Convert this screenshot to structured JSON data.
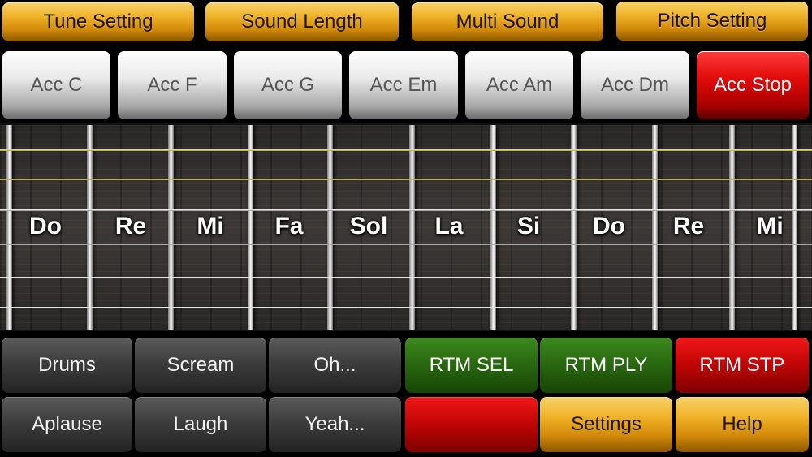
{
  "top_buttons": {
    "tune": "Tune Setting",
    "length": "Sound Length",
    "multi": "Multi Sound",
    "pitch": "Pitch Setting"
  },
  "accords": {
    "c": "Acc C",
    "f": "Acc F",
    "g": "Acc G",
    "em": "Acc Em",
    "am": "Acc Am",
    "dm": "Acc Dm",
    "stop": "Acc Stop"
  },
  "notes": [
    "Do",
    "Re",
    "Mi",
    "Fa",
    "Sol",
    "La",
    "Si",
    "Do",
    "Re",
    "Mi"
  ],
  "sound_pads": {
    "drums": "Drums",
    "scream": "Scream",
    "oh": "Oh...",
    "applause": "Aplause",
    "laugh": "Laugh",
    "yeah": "Yeah..."
  },
  "rhythm": {
    "select": "RTM SEL",
    "play": "RTM PLY",
    "stop": "RTM STP"
  },
  "menu": {
    "blank": "",
    "settings": "Settings",
    "help": "Help"
  },
  "colors": {
    "gold": "#f0b32a",
    "silver": "#e9e9e9",
    "stop_red": "#e20b0b",
    "rhythm_green": "#2a6a10",
    "pad_dark": "#3d3d3d"
  }
}
